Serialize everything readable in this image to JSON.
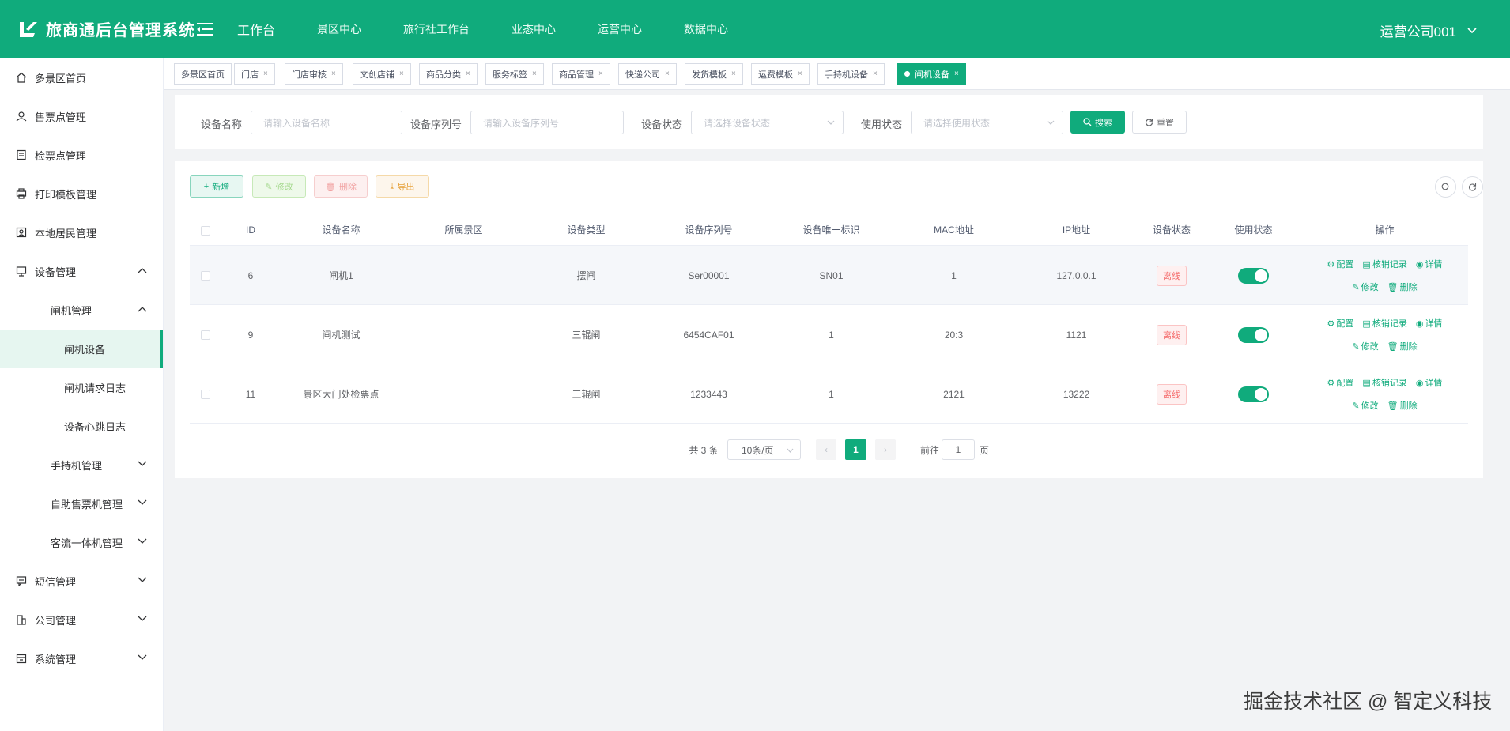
{
  "header": {
    "brand": "旅商通后台管理系统",
    "nav": [
      "工作台",
      "景区中心",
      "旅行社工作台",
      "业态中心",
      "运营中心",
      "数据中心"
    ],
    "user": "运营公司001"
  },
  "sidebar": [
    {
      "label": "多景区首页",
      "icon": "home-icon"
    },
    {
      "label": "售票点管理",
      "icon": "ticket-point-icon"
    },
    {
      "label": "检票点管理",
      "icon": "check-point-icon"
    },
    {
      "label": "打印模板管理",
      "icon": "print-template-icon"
    },
    {
      "label": "本地居民管理",
      "icon": "resident-icon"
    },
    {
      "label": "设备管理",
      "icon": "device-icon",
      "expanded": true
    },
    {
      "label": "闸机管理",
      "expanded": true
    },
    {
      "label": "闸机设备",
      "active": true
    },
    {
      "label": "闸机请求日志"
    },
    {
      "label": "设备心跳日志"
    },
    {
      "label": "手持机管理"
    },
    {
      "label": "自助售票机管理"
    },
    {
      "label": "客流一体机管理"
    },
    {
      "label": "短信管理",
      "icon": "sms-icon"
    },
    {
      "label": "公司管理",
      "icon": "company-icon"
    },
    {
      "label": "系统管理",
      "icon": "system-icon"
    }
  ],
  "tags": [
    "多景区首页",
    "门店",
    "门店审核",
    "文创店铺",
    "商品分类",
    "服务标签",
    "商品管理",
    "快递公司",
    "发货模板",
    "运费模板",
    "手持机设备",
    "闸机设备"
  ],
  "search": {
    "name_label": "设备名称",
    "name_placeholder": "请输入设备名称",
    "serial_label": "设备序列号",
    "serial_placeholder": "请输入设备序列号",
    "status_label": "设备状态",
    "status_placeholder": "请选择设备状态",
    "use_label": "使用状态",
    "use_placeholder": "请选择使用状态",
    "search_btn": "搜索",
    "reset_btn": "重置"
  },
  "toolbar": {
    "add": "新增",
    "edit": "修改",
    "delete": "删除",
    "export": "导出"
  },
  "table": {
    "columns": [
      "ID",
      "设备名称",
      "所属景区",
      "设备类型",
      "设备序列号",
      "设备唯一标识",
      "MAC地址",
      "IP地址",
      "设备状态",
      "使用状态",
      "操作"
    ],
    "rows": [
      {
        "id": "6",
        "name": "闸机1",
        "scenic": "",
        "type": "摆闸",
        "serial": "Ser00001",
        "uid": "SN01",
        "mac": "1",
        "ip": "127.0.0.1",
        "status": "离线",
        "enabled": true
      },
      {
        "id": "9",
        "name": "闸机测试",
        "scenic": "",
        "type": "三辊闸",
        "serial": "6454CAF01",
        "uid": "1",
        "mac": "20:3",
        "ip": "1121",
        "status": "离线",
        "enabled": true
      },
      {
        "id": "11",
        "name": "景区大门处检票点",
        "scenic": "",
        "type": "三辊闸",
        "serial": "1233443",
        "uid": "1",
        "mac": "2121",
        "ip": "13222",
        "status": "离线",
        "enabled": true
      }
    ],
    "ops": {
      "config": "配置",
      "log": "核销记录",
      "detail": "详情",
      "edit": "修改",
      "delete": "删除"
    }
  },
  "pager": {
    "total": "共 3 条",
    "size": "10条/页",
    "current": "1",
    "goto": "前往",
    "goto_value": "1",
    "page_unit": "页"
  },
  "watermark": "掘金技术社区 @ 智定义科技",
  "colors": {
    "primary": "#10ab7c",
    "danger": "#f56c6c",
    "warning": "#e6a23c"
  }
}
